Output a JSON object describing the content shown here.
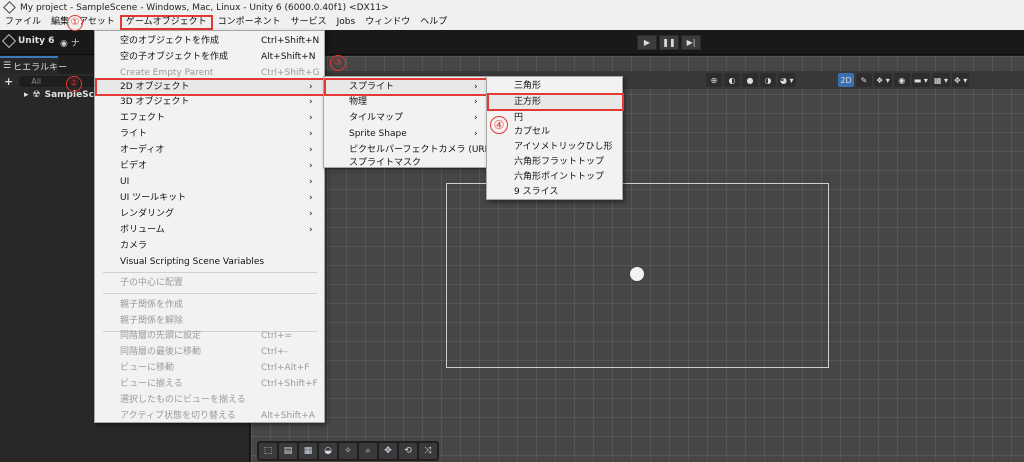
{
  "window": {
    "title": "My project - SampleScene - Windows, Mac, Linux - Unity 6 (6000.0.40f1) <DX11>"
  },
  "menubar": {
    "items": [
      {
        "label": "ファイル"
      },
      {
        "label": "編集"
      },
      {
        "label": "アセット"
      },
      {
        "label": "ゲームオブジェクト",
        "active": true
      },
      {
        "label": "コンポーネント"
      },
      {
        "label": "サービス"
      },
      {
        "label": "Jobs"
      },
      {
        "label": "ウィンドウ"
      },
      {
        "label": "ヘルプ"
      }
    ]
  },
  "toolbar": {
    "unity_label": "Unity 6",
    "account_label": "ナ",
    "play_icon": "play-icon",
    "pause_icon": "pause-icon",
    "step_icon": "step-icon"
  },
  "hierarchy": {
    "tab_label": "ヒエラルキー",
    "add_label": "+",
    "search_placeholder": "All",
    "scene_name": "SampleScene"
  },
  "scene_view": {
    "mode_2d_label": "2D"
  },
  "gameobject_menu": {
    "items": [
      {
        "label": "空のオブジェクトを作成",
        "shortcut": "Ctrl+Shift+N",
        "enabled": true
      },
      {
        "label": "空の子オブジェクトを作成",
        "shortcut": "Alt+Shift+N",
        "enabled": true
      },
      {
        "label": "Create Empty Parent",
        "shortcut": "Ctrl+Shift+G",
        "enabled": false
      },
      {
        "label": "2D オブジェクト",
        "submenu": true,
        "enabled": true,
        "highlighted": true
      },
      {
        "label": "3D オブジェクト",
        "submenu": true,
        "enabled": true
      },
      {
        "label": "エフェクト",
        "submenu": true,
        "enabled": true
      },
      {
        "label": "ライト",
        "submenu": true,
        "enabled": true
      },
      {
        "label": "オーディオ",
        "submenu": true,
        "enabled": true
      },
      {
        "label": "ビデオ",
        "submenu": true,
        "enabled": true
      },
      {
        "label": "UI",
        "submenu": true,
        "enabled": true
      },
      {
        "label": "UI ツールキット",
        "submenu": true,
        "enabled": true
      },
      {
        "label": "レンダリング",
        "submenu": true,
        "enabled": true
      },
      {
        "label": "ボリューム",
        "submenu": true,
        "enabled": true
      },
      {
        "label": "カメラ",
        "enabled": true
      },
      {
        "label": "Visual Scripting Scene Variables",
        "enabled": true
      },
      {
        "label": "子の中心に配置",
        "enabled": false
      },
      {
        "label": "親子関係を作成",
        "enabled": false
      },
      {
        "label": "親子関係を解除",
        "enabled": false
      },
      {
        "label": "同階層の先頭に設定",
        "shortcut": "Ctrl+=",
        "enabled": false
      },
      {
        "label": "同階層の最後に移動",
        "shortcut": "Ctrl+-",
        "enabled": false
      },
      {
        "label": "ビューに移動",
        "shortcut": "Ctrl+Alt+F",
        "enabled": false
      },
      {
        "label": "ビューに揃える",
        "shortcut": "Ctrl+Shift+F",
        "enabled": false
      },
      {
        "label": "選択したものにビューを揃える",
        "enabled": false
      },
      {
        "label": "アクティブ状態を切り替える",
        "shortcut": "Alt+Shift+A",
        "enabled": false
      }
    ]
  },
  "object2d_menu": {
    "items": [
      {
        "label": "スプライト",
        "submenu": true,
        "highlighted": true
      },
      {
        "label": "物理",
        "submenu": true
      },
      {
        "label": "タイルマップ",
        "submenu": true
      },
      {
        "label": "Sprite Shape",
        "submenu": true
      },
      {
        "label": "ピクセルパーフェクトカメラ (URP)"
      },
      {
        "label": "スプライトマスク"
      }
    ]
  },
  "sprite_menu": {
    "items": [
      {
        "label": "三角形"
      },
      {
        "label": "正方形",
        "highlighted": true
      },
      {
        "label": "円"
      },
      {
        "label": "カプセル"
      },
      {
        "label": "アイソメトリックひし形"
      },
      {
        "label": "六角形フラットトップ"
      },
      {
        "label": "六角形ポイントトップ"
      },
      {
        "label": "9 スライス"
      }
    ]
  },
  "annotations": {
    "step1": "①",
    "step2": "②",
    "step3": "③",
    "step4": "④",
    "color": "#e53935"
  }
}
